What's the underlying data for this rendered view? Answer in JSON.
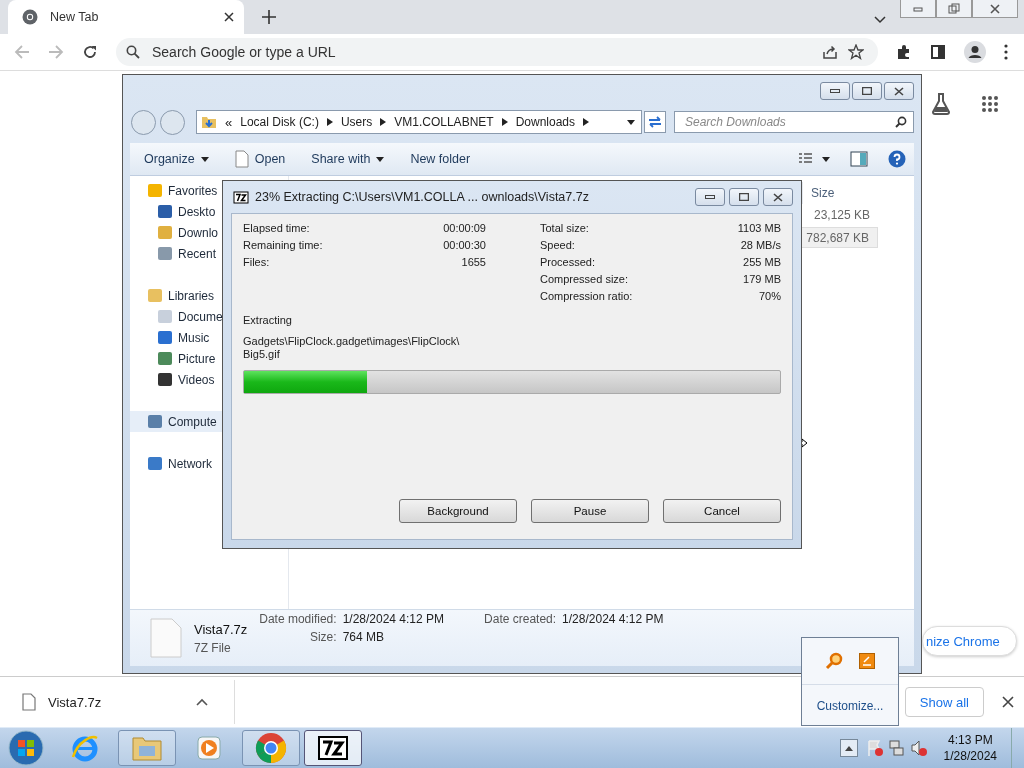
{
  "browser": {
    "tab": {
      "title": "New Tab",
      "selected": true
    },
    "omnibox": {
      "placeholder": "Search Google or type a URL"
    },
    "customize_button": "nize Chrome"
  },
  "explorer": {
    "breadcrumb_overflow": "«",
    "breadcrumb": [
      "Local Disk (C:)",
      "Users",
      "VM1.COLLABNET",
      "Downloads"
    ],
    "search": {
      "placeholder": "Search Downloads"
    },
    "toolbar": [
      {
        "label": "Organize",
        "kind": "menu"
      },
      {
        "label": "Open",
        "kind": "open"
      },
      {
        "label": "Share with",
        "kind": "menu"
      },
      {
        "label": "New folder",
        "kind": "plain"
      }
    ],
    "nav": [
      {
        "label": "Favorites",
        "kind": "star",
        "selected": false,
        "children": [
          {
            "label": "Deskto",
            "kind": "desktop",
            "selected": false
          },
          {
            "label": "Downlo",
            "kind": "downloads",
            "selected": false
          },
          {
            "label": "Recent",
            "kind": "recent",
            "selected": false
          }
        ]
      },
      {
        "label": "Libraries",
        "kind": "library",
        "selected": false,
        "children": [
          {
            "label": "Docume",
            "kind": "document",
            "selected": false
          },
          {
            "label": "Music",
            "kind": "music",
            "selected": false
          },
          {
            "label": "Picture",
            "kind": "pictures",
            "selected": false
          },
          {
            "label": "Videos",
            "kind": "videos",
            "selected": false
          }
        ]
      },
      {
        "label": "Compute",
        "kind": "computer",
        "selected": true
      },
      {
        "label": "Network",
        "kind": "network",
        "selected": false
      }
    ],
    "size_column": {
      "header": "Size",
      "rows": [
        {
          "size": "23,125 KB",
          "selected": false
        },
        {
          "size": "782,687 KB",
          "selected": true
        }
      ]
    },
    "details": {
      "name": "Vista7.7z",
      "type": "7Z File",
      "fields": [
        {
          "label": "Date modified:",
          "value": "1/28/2024 4:12 PM"
        },
        {
          "label": "Size:",
          "value": "764 MB"
        },
        {
          "label": "Date created:",
          "value": "1/28/2024 4:12 PM"
        }
      ]
    }
  },
  "dialog": {
    "title": "23% Extracting C:\\Users\\VM1.COLLA ... ownloads\\Vista7.7z",
    "left_stats": [
      {
        "label": "Elapsed time:",
        "value": "00:00:09"
      },
      {
        "label": "Remaining time:",
        "value": "00:00:30"
      },
      {
        "label": "Files:",
        "value": "1655"
      }
    ],
    "right_stats": [
      {
        "label": "Total size:",
        "value": "1103 MB"
      },
      {
        "label": "Speed:",
        "value": "28 MB/s"
      },
      {
        "label": "Processed:",
        "value": "255 MB"
      },
      {
        "label": "Compressed size:",
        "value": "179 MB"
      },
      {
        "label": "Compression ratio:",
        "value": "70%"
      }
    ],
    "status": "Extracting",
    "path_lines": [
      "Gadgets\\FlipClock.gadget\\images\\FlipClock\\",
      "Big5.gif"
    ],
    "progress": {
      "level": 0.23
    },
    "buttons": [
      "Background",
      "Pause",
      "Cancel"
    ]
  },
  "tray_popup": {
    "link": "Customize..."
  },
  "download_shelf": {
    "file": "Vista7.7z",
    "show_all": "Show all"
  },
  "taskbar": {
    "apps": [
      {
        "kind": "ie",
        "running": false,
        "active": false
      },
      {
        "kind": "explorer",
        "running": true,
        "active": false
      },
      {
        "kind": "media",
        "running": false,
        "active": false
      },
      {
        "kind": "chrome",
        "running": true,
        "active": false
      },
      {
        "kind": "sevenzip",
        "running": true,
        "active": true
      }
    ],
    "time": "4:13 PM",
    "date": "1/28/2024"
  }
}
